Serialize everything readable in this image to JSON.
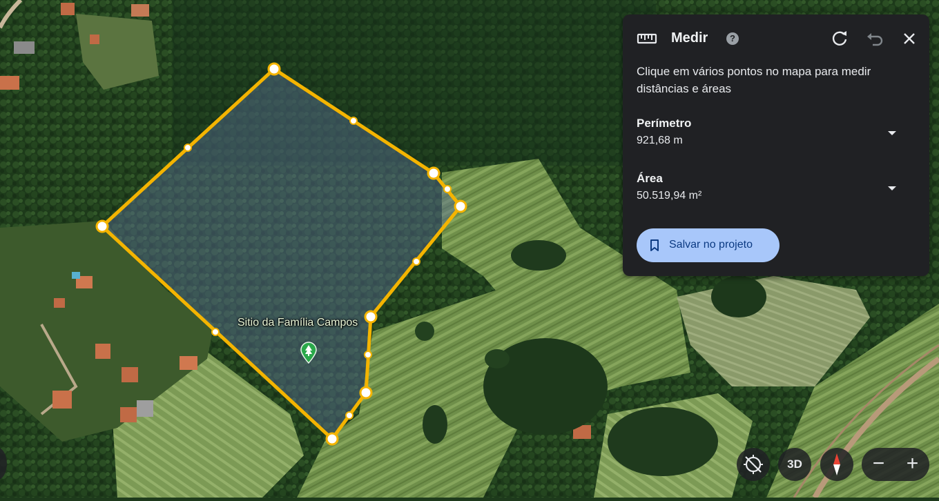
{
  "map": {
    "place_label": "Sitio da Família Campos",
    "place_icon": "tree-pin-icon",
    "measure_color": "#f4b400",
    "area_fill": "#5a6e9a"
  },
  "measure_panel": {
    "title": "Medir",
    "ruler_icon": "ruler-icon",
    "help_symbol": "?",
    "instructions": "Clique em vários pontos no mapa para medir distâncias e áreas",
    "perimeter_label": "Perímetro",
    "perimeter_value": "921,68 m",
    "area_label": "Área",
    "area_value": "50.519,94 m²",
    "save_label": "Salvar no projeto",
    "accent": "#a8c7fa"
  },
  "controls": {
    "view3d_label": "3D",
    "zoom_out": "−",
    "zoom_in": "+"
  }
}
